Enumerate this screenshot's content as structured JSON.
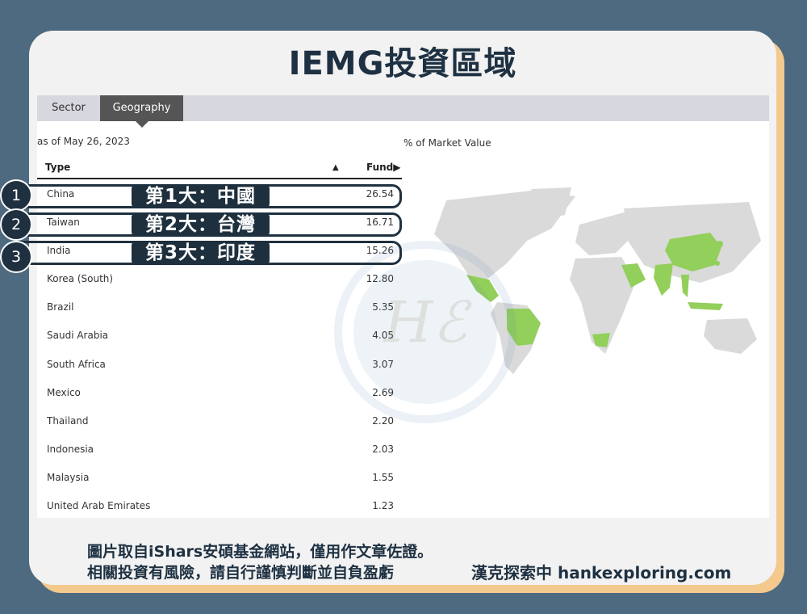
{
  "title": "IEMG投資區域",
  "tabs": [
    {
      "label": "Sector",
      "active": false
    },
    {
      "label": "Geography",
      "active": true
    }
  ],
  "as_of": "as of May 26, 2023",
  "map_label": "% of Market Value",
  "table": {
    "col_type": "Type",
    "sort_indicator": "▲",
    "col_fund": "Fund▶",
    "rows": [
      {
        "name": "China",
        "value": "26.54"
      },
      {
        "name": "Taiwan",
        "value": "16.71"
      },
      {
        "name": "India",
        "value": "15.26"
      },
      {
        "name": "Korea (South)",
        "value": "12.80"
      },
      {
        "name": "Brazil",
        "value": "5.35"
      },
      {
        "name": "Saudi Arabia",
        "value": "4.05"
      },
      {
        "name": "South Africa",
        "value": "3.07"
      },
      {
        "name": "Mexico",
        "value": "2.69"
      },
      {
        "name": "Thailand",
        "value": "2.20"
      },
      {
        "name": "Indonesia",
        "value": "2.03"
      },
      {
        "name": "Malaysia",
        "value": "1.55"
      },
      {
        "name": "United Arab Emirates",
        "value": "1.23"
      }
    ]
  },
  "highlights": [
    {
      "number": "1",
      "label": "第1大：中國"
    },
    {
      "number": "2",
      "label": "第2大：台灣"
    },
    {
      "number": "3",
      "label": "第3大：印度"
    }
  ],
  "watermark": "Hℰ",
  "footer": {
    "line1": "圖片取自iShars安碩基金網站，僅用作文章佐證。",
    "line2": "相關投資有風險，請自行謹慎判斷並自負盈虧",
    "credit": "漢克探索中 hankexploring.com"
  },
  "colors": {
    "background": "#4e6a80",
    "accent_shadow": "#f3c98e",
    "navy": "#1e3142",
    "map_highlight": "#92cf5b",
    "map_land": "#dadada"
  }
}
